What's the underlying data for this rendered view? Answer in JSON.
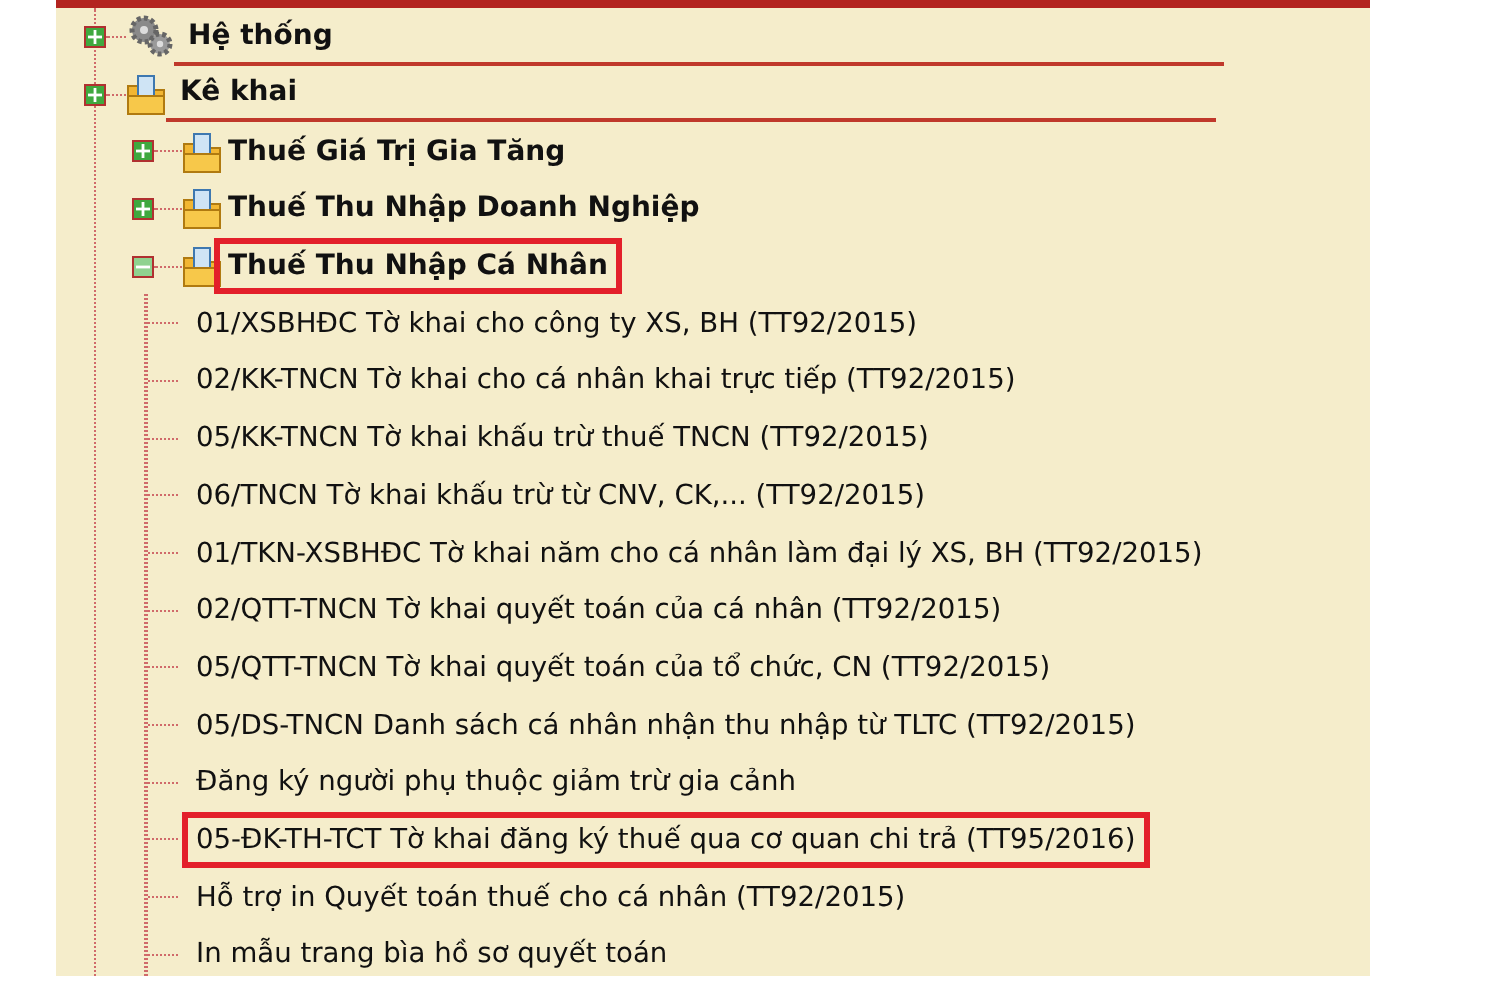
{
  "tree": [
    {
      "label": "Hệ thống",
      "kind": "gear",
      "expanded": false,
      "highlighted": false
    },
    {
      "label": "Kê khai",
      "kind": "folder",
      "expanded": false,
      "highlighted": false,
      "children": [
        {
          "label": "Thuế Giá Trị Gia Tăng",
          "kind": "folder",
          "expanded": false,
          "highlighted": false
        },
        {
          "label": "Thuế Thu Nhập Doanh Nghiệp",
          "kind": "folder",
          "expanded": false,
          "highlighted": false
        },
        {
          "label": "Thuế Thu Nhập Cá Nhân",
          "kind": "folder",
          "expanded": true,
          "highlighted": true,
          "children": [
            {
              "label": "01/XSBHĐC Tờ khai cho công ty XS, BH (TT92/2015)",
              "highlighted": false
            },
            {
              "label": "02/KK-TNCN Tờ khai cho cá nhân khai trực tiếp (TT92/2015)",
              "highlighted": false
            },
            {
              "label": "05/KK-TNCN Tờ khai khấu trừ thuế TNCN (TT92/2015)",
              "highlighted": false
            },
            {
              "label": "06/TNCN Tờ khai khấu trừ từ CNV, CK,... (TT92/2015)",
              "highlighted": false
            },
            {
              "label": "01/TKN-XSBHĐC Tờ khai năm cho cá nhân làm đại lý XS, BH (TT92/2015)",
              "highlighted": false
            },
            {
              "label": "02/QTT-TNCN Tờ khai quyết toán của cá nhân (TT92/2015)",
              "highlighted": false
            },
            {
              "label": "05/QTT-TNCN Tờ khai quyết toán của tổ chức, CN (TT92/2015)",
              "highlighted": false
            },
            {
              "label": "05/DS-TNCN Danh sách cá nhân nhận thu nhập từ TLTC (TT92/2015)",
              "highlighted": false
            },
            {
              "label": "Đăng ký người phụ thuộc giảm trừ gia cảnh",
              "highlighted": false
            },
            {
              "label": "05-ĐK-TH-TCT Tờ khai đăng ký thuế qua cơ quan chi trả (TT95/2016)",
              "highlighted": true
            },
            {
              "label": "Hỗ trợ in Quyết toán thuế cho cá nhân (TT92/2015)",
              "highlighted": false
            },
            {
              "label": "In mẫu trang bìa hồ sơ quyết toán",
              "highlighted": false
            }
          ]
        }
      ]
    }
  ]
}
